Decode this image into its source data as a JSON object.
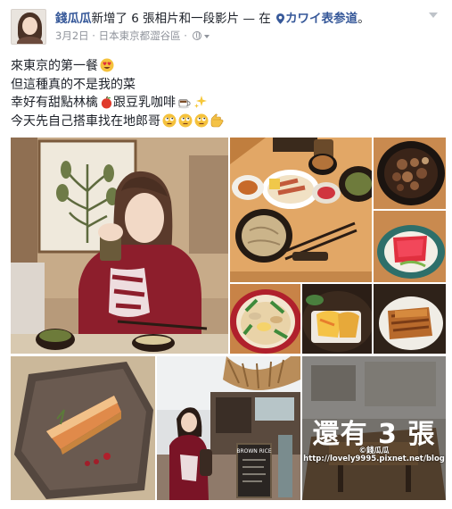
{
  "post": {
    "author": "錢瓜瓜",
    "action": "新增了 6 張相片和一段影片 — 在",
    "place": "カワイ表参道",
    "place_suffix": "。",
    "date": "3月2日",
    "location": "日本東京都澀谷區",
    "separator": " · "
  },
  "body_lines": [
    "來東京的第一餐",
    "但這種真的不是我的菜",
    "幸好有甜點林檎",
    "今天先自己搭車找在地郎哥"
  ],
  "body_inline": {
    "between_apple_and_coffee": "跟豆乳咖啡"
  },
  "photos": {
    "more_label": "還有 3 張",
    "watermark_line1": "©錢瓜瓜",
    "watermark_line2": "http://lovely9995.pixnet.net/blog",
    "menu_board_text": "BROWN RICE"
  },
  "icons": {
    "options": "chevron-down-icon",
    "location": "map-pin-icon",
    "privacy": "globe-icon"
  },
  "colors": {
    "link": "#365899",
    "meta": "#90949c",
    "text": "#1d2129"
  }
}
